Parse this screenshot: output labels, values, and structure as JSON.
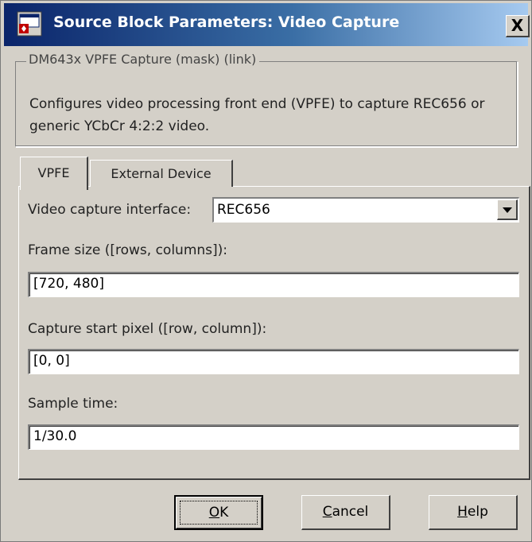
{
  "window": {
    "title": "Source Block Parameters: Video Capture",
    "close_glyph": "X"
  },
  "mask": {
    "legend": "DM643x VPFE Capture (mask) (link)",
    "description": "Configures video processing front end (VPFE) to capture REC656 or generic YCbCr 4:2:2 video."
  },
  "tabs": [
    {
      "label": "VPFE",
      "selected": true
    },
    {
      "label": "External Device",
      "selected": false
    }
  ],
  "params": {
    "video_capture_interface_label": "Video capture interface:",
    "video_capture_interface_value": "REC656",
    "frame_size_label": "Frame size ([rows, columns]):",
    "frame_size_value": "[720, 480]",
    "capture_start_label": "Capture start pixel ([row, column]):",
    "capture_start_value": "[0, 0]",
    "sample_time_label": "Sample time:",
    "sample_time_value": "1/30.0"
  },
  "buttons": {
    "ok": {
      "label": "OK",
      "mnemonic": "O",
      "rest": "K"
    },
    "cancel": {
      "label": "Cancel",
      "mnemonic": "C",
      "rest": "ancel"
    },
    "help": {
      "label": "Help",
      "mnemonic": "H",
      "rest": "elp"
    }
  },
  "icons": {
    "app": "simulink-block-icon",
    "close": "close-icon",
    "dropdown": "chevron-down-icon"
  },
  "colors": {
    "title_gradient_start": "#0a246a",
    "title_gradient_end": "#a6caf0",
    "dialog_bg": "#d4d0c8"
  }
}
